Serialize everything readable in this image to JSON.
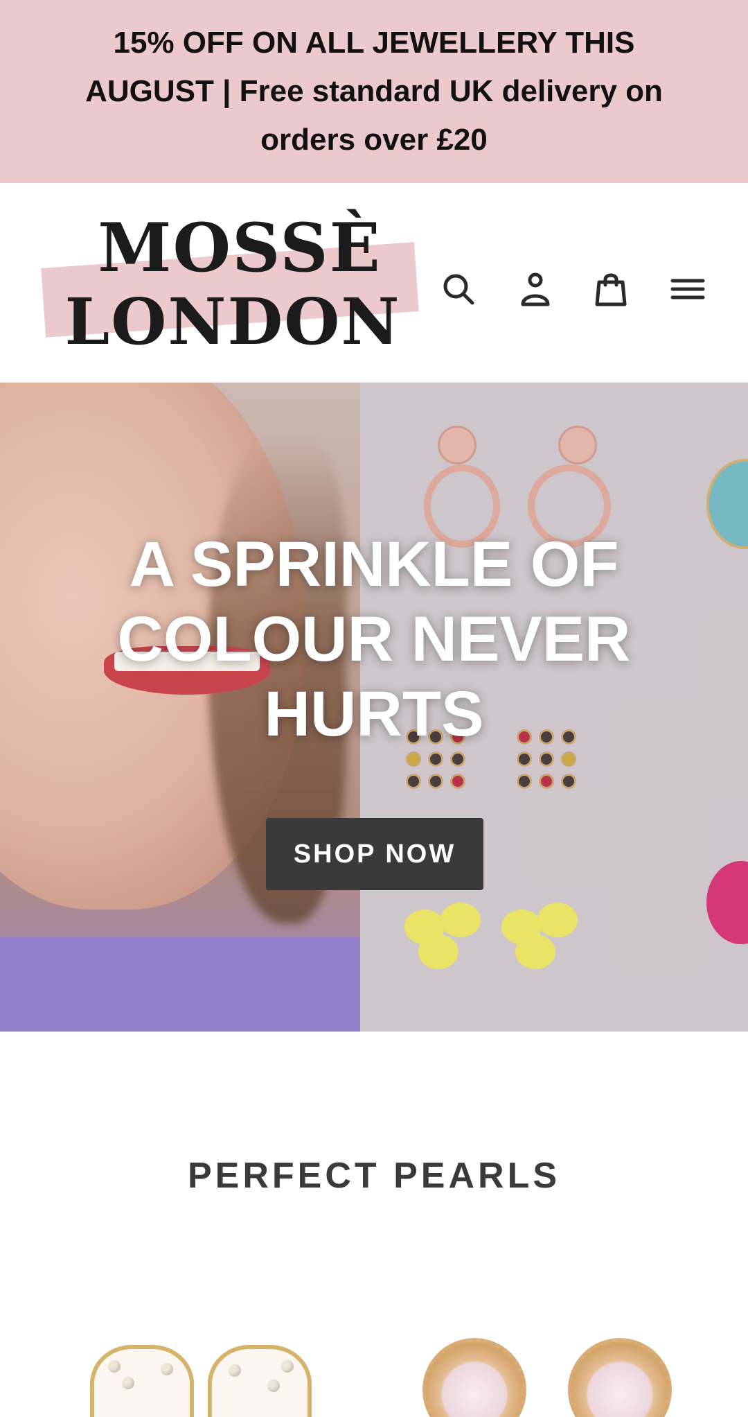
{
  "announcement": {
    "text": "15% OFF ON ALL JEWELLERY THIS AUGUST | Free standard UK delivery on orders over £20",
    "background": "#ecc9cc"
  },
  "header": {
    "logo": {
      "line1": "MOSSÈ",
      "line2": "LONDON"
    },
    "icons": [
      "search-icon",
      "account-icon",
      "cart-icon",
      "menu-icon"
    ]
  },
  "hero": {
    "title": "A SPRINKLE OF COLOUR NEVER HURTS",
    "cta_label": "SHOP NOW",
    "cta_color": "#3a3a3a"
  },
  "featured": {
    "title": "PERFECT PEARLS",
    "products": [
      {
        "image": "pearl-heart-earrings"
      },
      {
        "image": "pearl-stud-earrings"
      }
    ]
  }
}
